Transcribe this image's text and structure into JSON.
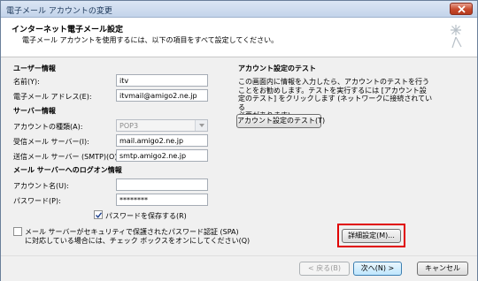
{
  "window": {
    "title": "電子メール アカウントの変更"
  },
  "header": {
    "title": "インターネット電子メール設定",
    "subtitle": "電子メール アカウントを使用するには、以下の項目をすべて設定してください。"
  },
  "user_info": {
    "heading": "ユーザー情報",
    "name_label": "名前(Y):",
    "name_value": "itv",
    "email_label": "電子メール アドレス(E):",
    "email_value": "itvmail@amigo2.ne.jp"
  },
  "server_info": {
    "heading": "サーバー情報",
    "account_type_label": "アカウントの種類(A):",
    "account_type_value": "POP3",
    "incoming_label": "受信メール サーバー(I):",
    "incoming_value": "mail.amigo2.ne.jp",
    "outgoing_label": "送信メール サーバー (SMTP)(O):",
    "outgoing_value": "smtp.amigo2.ne.jp"
  },
  "logon_info": {
    "heading": "メール サーバーへのログオン情報",
    "account_name_label": "アカウント名(U):",
    "account_name_value": "",
    "password_label": "パスワード(P):",
    "password_value": "********",
    "save_password_label": "パスワードを保存する(R)",
    "save_password_checked": true
  },
  "spa": {
    "line1": "メール サーバーがセキュリティで保護されたパスワード認証 (SPA)",
    "line2": "に対応している場合には、チェック ボックスをオンにしてください(Q)",
    "checked": false
  },
  "test": {
    "heading": "アカウント設定のテスト",
    "desc_line1": "この画面内に情報を入力したら、アカウントのテストを行う",
    "desc_line2": "ことをお勧めします。テストを実行するには [アカウント設",
    "desc_line3": "定のテスト] をクリックします (ネットワークに接続されている",
    "desc_line4": "必要があります)。",
    "test_button": "アカウント設定のテスト(T)"
  },
  "buttons": {
    "advanced": "詳細設定(M)...",
    "back": "< 戻る(B)",
    "next": "次へ(N) >",
    "cancel": "キャンセル"
  },
  "colors": {
    "highlight": "#e00000",
    "close_button": "#c84a2c",
    "titlebar": "#c3d4ea"
  }
}
